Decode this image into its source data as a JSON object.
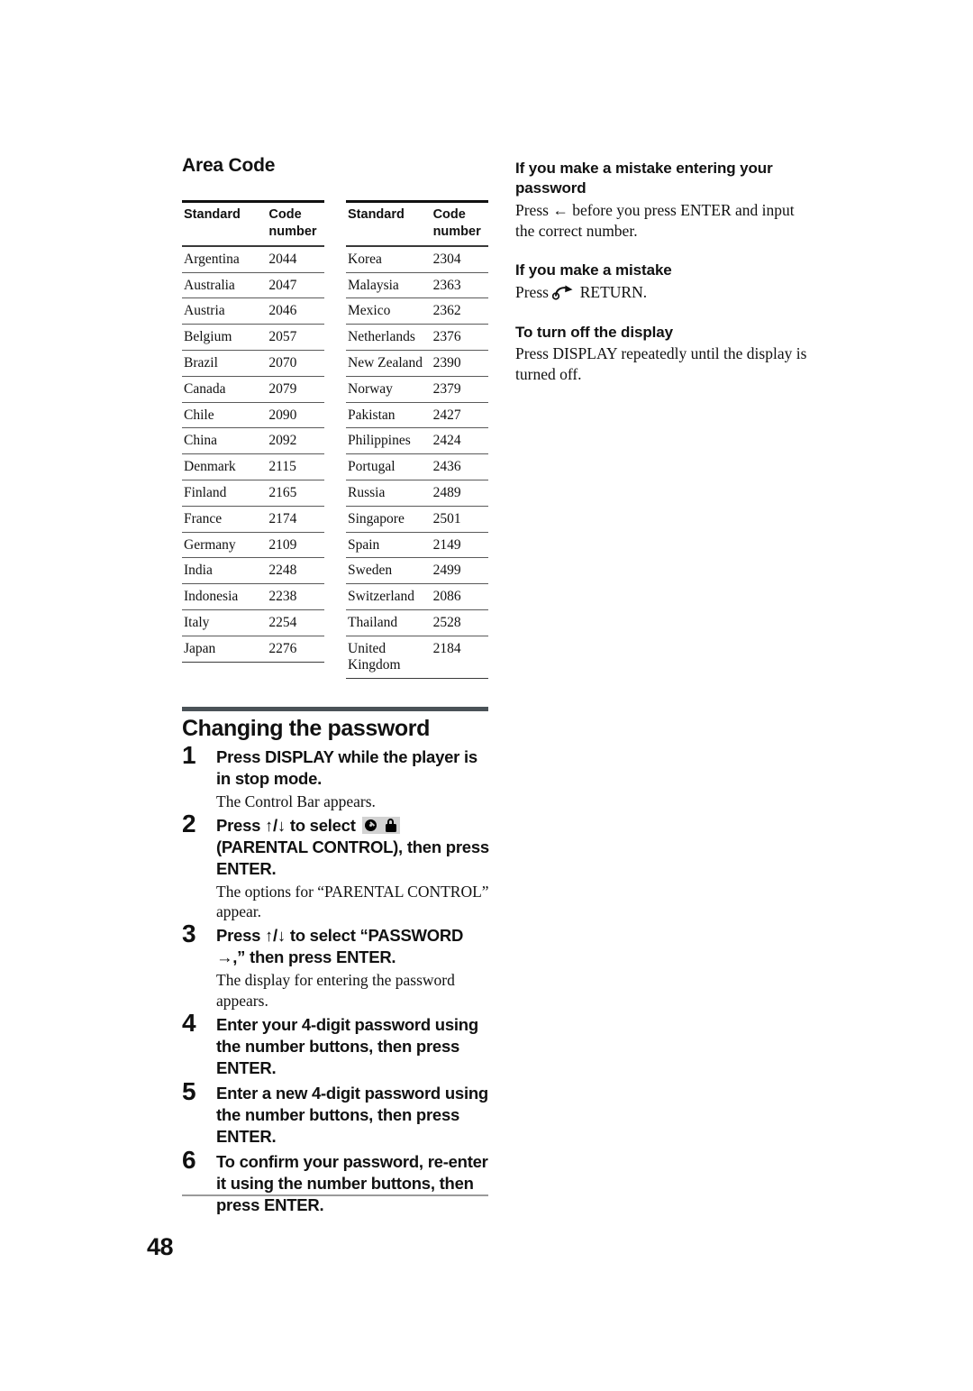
{
  "page": {
    "number": "48"
  },
  "area_code": {
    "title": "Area Code",
    "columns": [
      "Standard",
      "Code number"
    ],
    "header": {
      "standard": "Standard",
      "code_line1": "Code",
      "code_line2": "number"
    },
    "left_rows": [
      {
        "standard": "Argentina",
        "code": "2044"
      },
      {
        "standard": "Australia",
        "code": "2047"
      },
      {
        "standard": "Austria",
        "code": "2046"
      },
      {
        "standard": "Belgium",
        "code": "2057"
      },
      {
        "standard": "Brazil",
        "code": "2070"
      },
      {
        "standard": "Canada",
        "code": "2079"
      },
      {
        "standard": "Chile",
        "code": "2090"
      },
      {
        "standard": "China",
        "code": "2092"
      },
      {
        "standard": "Denmark",
        "code": "2115"
      },
      {
        "standard": "Finland",
        "code": "2165"
      },
      {
        "standard": "France",
        "code": "2174"
      },
      {
        "standard": "Germany",
        "code": "2109"
      },
      {
        "standard": "India",
        "code": "2248"
      },
      {
        "standard": "Indonesia",
        "code": "2238"
      },
      {
        "standard": "Italy",
        "code": "2254"
      },
      {
        "standard": "Japan",
        "code": "2276"
      }
    ],
    "right_rows": [
      {
        "standard": "Korea",
        "code": "2304"
      },
      {
        "standard": "Malaysia",
        "code": "2363"
      },
      {
        "standard": "Mexico",
        "code": "2362"
      },
      {
        "standard": "Netherlands",
        "code": "2376"
      },
      {
        "standard": "New Zealand",
        "code": "2390"
      },
      {
        "standard": "Norway",
        "code": "2379"
      },
      {
        "standard": "Pakistan",
        "code": "2427"
      },
      {
        "standard": "Philippines",
        "code": "2424"
      },
      {
        "standard": "Portugal",
        "code": "2436"
      },
      {
        "standard": "Russia",
        "code": "2489"
      },
      {
        "standard": "Singapore",
        "code": "2501"
      },
      {
        "standard": "Spain",
        "code": "2149"
      },
      {
        "standard": "Sweden",
        "code": "2499"
      },
      {
        "standard": "Switzerland",
        "code": "2086"
      },
      {
        "standard": "Thailand",
        "code": "2528"
      },
      {
        "standard": "United Kingdom",
        "code": "2184"
      }
    ]
  },
  "right_column": {
    "blocks": [
      {
        "heading": "If you make a mistake entering your password",
        "body_prefix": "Press ",
        "icon": "left-arrow-icon",
        "icon_glyph": "←",
        "body_suffix": " before you press ENTER and input the correct number."
      },
      {
        "heading": "If you make a mistake",
        "body_prefix": "Press ",
        "icon": "return-icon",
        "body_suffix": " RETURN."
      },
      {
        "heading": "To turn off the display",
        "body_prefix": "",
        "icon": null,
        "body_suffix": "Press DISPLAY repeatedly until the display is turned off."
      }
    ]
  },
  "changing_password": {
    "title": "Changing the password",
    "steps": [
      {
        "number": "1",
        "text": "Press DISPLAY while the player is in stop mode.",
        "note": "The Control Bar appears."
      },
      {
        "number": "2",
        "text_before_icon": "Press ↑/↓ to select ",
        "icon": "parental-control-icon",
        "text_after_icon": " (PARENTAL CONTROL), then press ENTER.",
        "note": "The options for “PARENTAL CONTROL” appear."
      },
      {
        "number": "3",
        "text": "Press ↑/↓ to select “PASSWORD →,” then press ENTER.",
        "note": "The display for entering the password appears."
      },
      {
        "number": "4",
        "text": "Enter your 4-digit password using the number buttons, then press ENTER.",
        "note": ""
      },
      {
        "number": "5",
        "text": "Enter a new 4-digit password using the number buttons, then press ENTER.",
        "note": ""
      },
      {
        "number": "6",
        "text": "To confirm your password, re-enter it using the number buttons, then press ENTER.",
        "note": ""
      }
    ]
  },
  "colors": {
    "rule_bar": "#4a5257",
    "table_rule": "#3a3a3a",
    "footer_rule": "#9a9a9a",
    "icon_background": "#d2d2d2",
    "text": "#111111"
  }
}
